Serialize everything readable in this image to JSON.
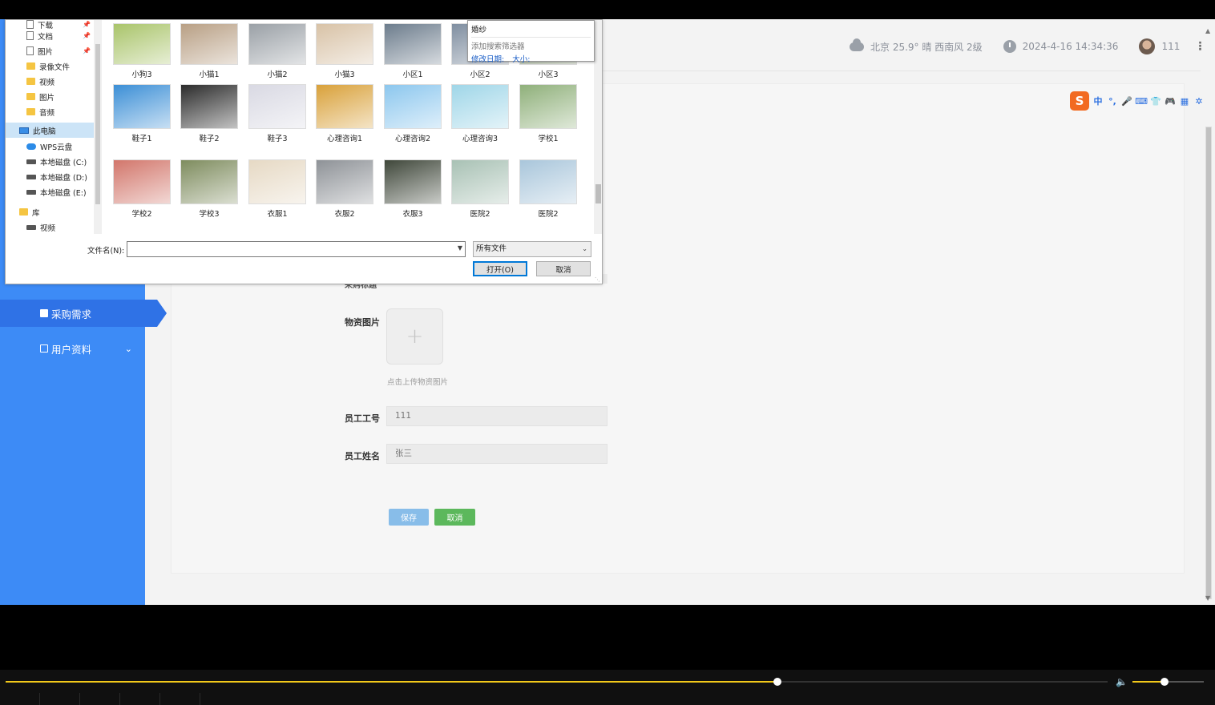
{
  "topbar": {
    "weather": "北京 25.9° 晴 西南风 2级",
    "datetime": "2024-4-16 14:34:36",
    "username": "111"
  },
  "sidebar": {
    "items": [
      {
        "label": "采购需求",
        "icon": "clipboard-icon",
        "active": true
      },
      {
        "label": "用户资料",
        "icon": "folder-icon",
        "active": false
      }
    ]
  },
  "form": {
    "partial_label": "采购标题",
    "photo_label": "物资图片",
    "upload_plus": "+",
    "upload_hint": "点击上传物资图片",
    "emp_id_label": "员工工号",
    "emp_id_value": "111",
    "emp_name_label": "员工姓名",
    "emp_name_value": "张三",
    "save_label": "保存",
    "cancel_label": "取消"
  },
  "ime": {
    "logo": "S",
    "items": [
      "中",
      "°,",
      "🎤",
      "⌨",
      "👕",
      "🎮",
      "▦",
      "✲"
    ]
  },
  "dialog": {
    "nav": [
      {
        "label": "下载",
        "icon": "download-icon",
        "pinned": true
      },
      {
        "label": "文档",
        "icon": "document-icon",
        "pinned": true
      },
      {
        "label": "图片",
        "icon": "pictures-icon",
        "pinned": true
      },
      {
        "label": "录像文件",
        "icon": "folder-icon",
        "pinned": false
      },
      {
        "label": "视频",
        "icon": "folder-icon",
        "pinned": false
      },
      {
        "label": "图片",
        "icon": "folder-icon",
        "pinned": false
      },
      {
        "label": "音频",
        "icon": "folder-icon",
        "pinned": false
      },
      {
        "label": "此电脑",
        "icon": "computer-icon",
        "pinned": false,
        "selected": true
      },
      {
        "label": "WPS云盘",
        "icon": "cloud-drive-icon",
        "pinned": false
      },
      {
        "label": "本地磁盘 (C:)",
        "icon": "drive-icon",
        "pinned": false
      },
      {
        "label": "本地磁盘 (D:)",
        "icon": "drive-icon",
        "pinned": false
      },
      {
        "label": "本地磁盘 (E:)",
        "icon": "drive-icon",
        "pinned": false
      },
      {
        "label": "库",
        "icon": "library-icon",
        "pinned": false
      },
      {
        "label": "视频",
        "icon": "video-library-icon",
        "pinned": false
      }
    ],
    "files": [
      {
        "name": "小狗3",
        "color": "#a9c46a"
      },
      {
        "name": "小猫1",
        "color": "#b89f84"
      },
      {
        "name": "小猫2",
        "color": "#9aa0a6"
      },
      {
        "name": "小猫3",
        "color": "#d8c2a6"
      },
      {
        "name": "小区1",
        "color": "#6c7c8c"
      },
      {
        "name": "小区2",
        "color": "#7f8ea0"
      },
      {
        "name": "小区3",
        "color": "#8c9f7c"
      },
      {
        "name": "鞋子1",
        "color": "#3c8fd6"
      },
      {
        "name": "鞋子2",
        "color": "#2b2b2b"
      },
      {
        "name": "鞋子3",
        "color": "#d9d9e3"
      },
      {
        "name": "心理咨询1",
        "color": "#d9a13a"
      },
      {
        "name": "心理咨询2",
        "color": "#8cc7ee"
      },
      {
        "name": "心理咨询3",
        "color": "#9fd6e8"
      },
      {
        "name": "学校1",
        "color": "#8fb07a"
      },
      {
        "name": "学校2",
        "color": "#d2766b"
      },
      {
        "name": "学校3",
        "color": "#7e8c5e"
      },
      {
        "name": "衣服1",
        "color": "#e6d9c4"
      },
      {
        "name": "衣服2",
        "color": "#8e9297"
      },
      {
        "name": "衣服3",
        "color": "#3f473a"
      },
      {
        "name": "医院2",
        "color": "#a8c1b4"
      },
      {
        "name": "医院2",
        "color": "#a9c6db"
      }
    ],
    "popup": {
      "title": "婚纱",
      "add_filter": "添加搜索筛选器",
      "modified": "修改日期:",
      "size": "大小:"
    },
    "filename_label": "文件名(N):",
    "filename_value": "",
    "filetype": "所有文件",
    "open_label": "打开(O)",
    "cancel_label": "取消"
  },
  "player": {
    "progress": 0.7,
    "volume": 0.45,
    "accent": "#f2c81a"
  }
}
